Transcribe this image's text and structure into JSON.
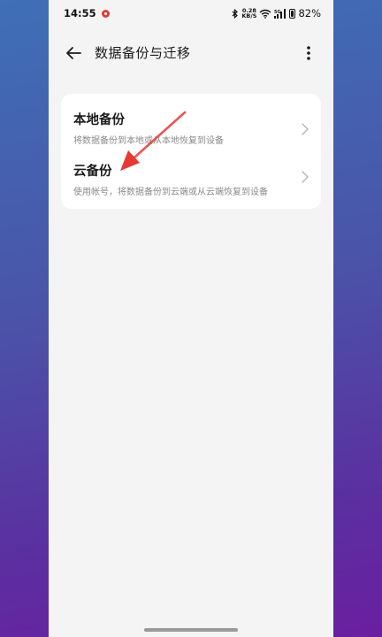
{
  "status_bar": {
    "time": "14:55",
    "net_speed_value": "0.28",
    "net_speed_unit": "KB/S",
    "battery_percent": "82%"
  },
  "app_bar": {
    "title": "数据备份与迁移"
  },
  "options": [
    {
      "title": "本地备份",
      "description": "将数据备份到本地或从本地恢复到设备"
    },
    {
      "title": "云备份",
      "description": "使用帐号，将数据备份到云端或从云端恢复到设备"
    }
  ],
  "colors": {
    "annotation_arrow": "#e53935",
    "page_background": "#f4f4f4",
    "card_background": "#ffffff"
  },
  "icons": {
    "back": "arrow-left-icon",
    "more": "more-vertical-icon",
    "chevron": "chevron-right-icon",
    "bluetooth": "bluetooth-icon",
    "wifi": "wifi-icon",
    "signal": "signal-icon",
    "battery": "battery-icon",
    "notification": "notification-app-icon"
  }
}
